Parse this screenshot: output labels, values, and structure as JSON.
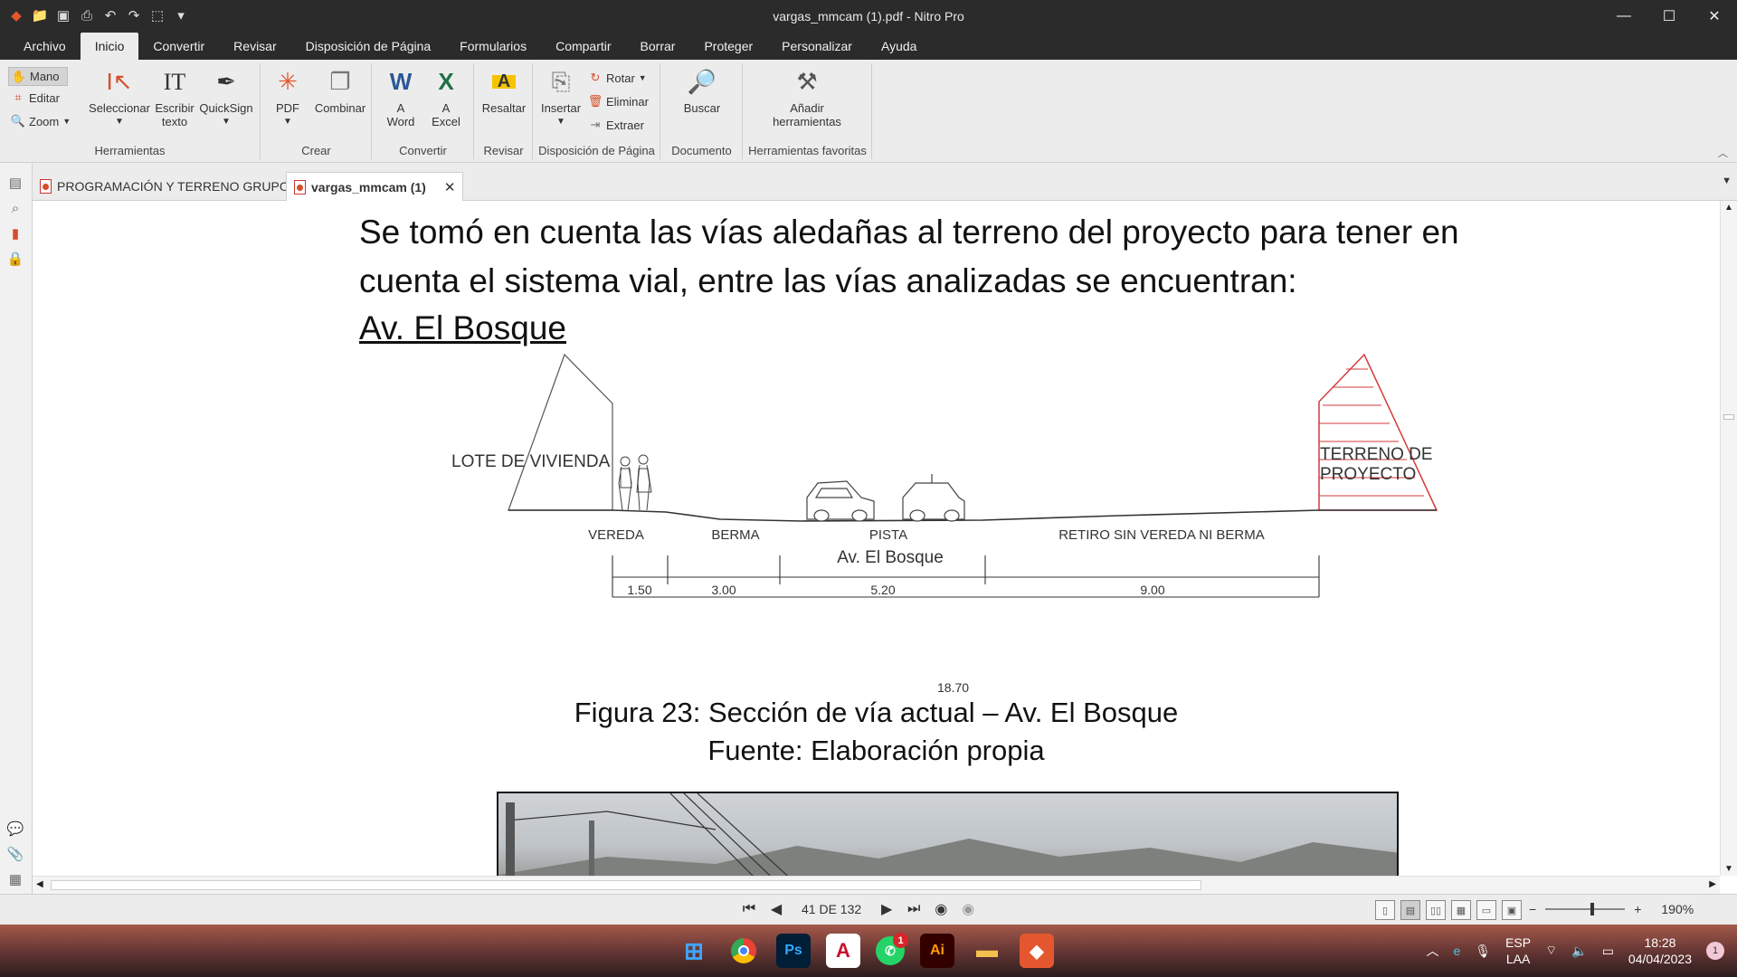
{
  "window": {
    "title": "vargas_mmcam (1).pdf - Nitro Pro",
    "controls": [
      "—",
      "☐",
      "✕"
    ]
  },
  "menu": {
    "items": [
      "Archivo",
      "Inicio",
      "Convertir",
      "Revisar",
      "Disposición de Página",
      "Formularios",
      "Compartir",
      "Borrar",
      "Proteger",
      "Personalizar",
      "Ayuda"
    ],
    "active": "Inicio"
  },
  "ribbon": {
    "mano": "Mano",
    "editar": "Editar",
    "zoom": "Zoom",
    "seleccionar": "Seleccionar",
    "escribir_texto": "Escribir texto",
    "quicksign": "QuickSign",
    "herramientas": "Herramientas",
    "pdf": "PDF",
    "combinar": "Combinar",
    "crear": "Crear",
    "a_word": "A Word",
    "a_excel": "A Excel",
    "convertir": "Convertir",
    "resaltar": "Resaltar",
    "revisar": "Revisar",
    "insertar": "Insertar",
    "rotar": "Rotar",
    "eliminar": "Eliminar",
    "extraer": "Extraer",
    "disposicion": "Disposición de Página",
    "buscar": "Buscar",
    "documento": "Documento",
    "anadir_herramientas": "Añadir herramientas",
    "favoritas": "Herramientas favoritas"
  },
  "tabs": [
    {
      "label": "PROGRAMACIÓN Y TERRENO GRUPO 6",
      "active": false
    },
    {
      "label": "vargas_mmcam (1)",
      "active": true
    }
  ],
  "document": {
    "line1": "Se tomó en cuenta las vías aledañas al terreno del proyecto para tener en",
    "line2": "cuenta el sistema vial, entre las vías analizadas se encuentran:",
    "heading": "Av. El Bosque",
    "figure": {
      "lote": "LOTE DE VIVIENDA",
      "terreno1": "TERRENO DE",
      "terreno2": "PROYECTO",
      "vereda": "VEREDA",
      "berma": "BERMA",
      "pista": "PISTA",
      "retiro": "RETIRO SIN VEREDA NI BERMA",
      "road_name": "Av. El Bosque",
      "dims": [
        "1.50",
        "3.00",
        "5.20",
        "9.00"
      ],
      "total": "18.70"
    },
    "caption1": "Figura 23: Sección de vía actual – Av. El Bosque",
    "caption2": "Fuente: Elaboración propia"
  },
  "status": {
    "page": "41 DE 132",
    "zoom": "190%"
  },
  "taskbar": {
    "whatsapp_badge": "1",
    "lang1": "ESP",
    "lang2": "LAA",
    "time": "18:28",
    "date": "04/04/2023",
    "notifications": "1"
  }
}
